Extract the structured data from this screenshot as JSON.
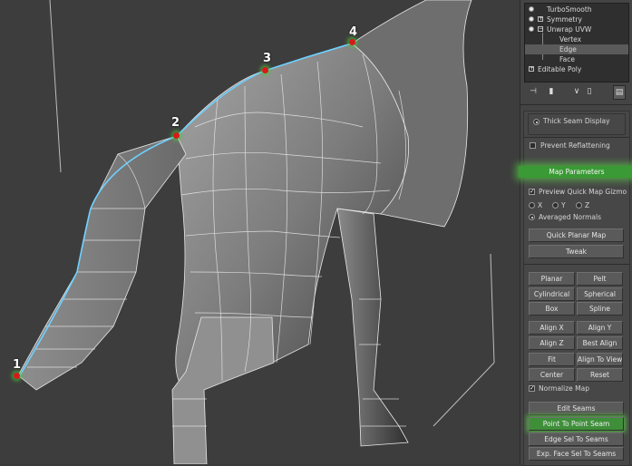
{
  "viewport": {
    "points": [
      {
        "label": "1"
      },
      {
        "label": "2"
      },
      {
        "label": "3"
      },
      {
        "label": "4"
      }
    ]
  },
  "modifier_stack": {
    "items": [
      {
        "label": "TurboSmooth",
        "selected": false
      },
      {
        "label": "Symmetry",
        "selected": false
      },
      {
        "label": "Unwrap UVW",
        "selected": false
      },
      {
        "label": "Vertex",
        "selected": false
      },
      {
        "label": "Edge",
        "selected": true
      },
      {
        "label": "Face",
        "selected": false
      },
      {
        "label": "Editable Poly",
        "selected": false
      }
    ],
    "toolbar_icons": [
      "pin-stack-icon",
      "show-end-result-icon",
      "make-unique-icon",
      "remove-modifier-icon",
      "configure-sets-icon"
    ]
  },
  "options": {
    "thick_seam_display": "Thick Seam Display",
    "prevent_reflattening": "Prevent Reflattening"
  },
  "map_parameters": {
    "header": "Map Parameters",
    "preview_quick_map_gizmo": "Preview Quick Map Gizmo",
    "axis_x": "X",
    "axis_y": "Y",
    "axis_z": "Z",
    "averaged_normals": "Averaged Normals",
    "quick_planar_map": "Quick Planar Map",
    "tweak": "Tweak",
    "planar": "Planar",
    "pelt": "Pelt",
    "cylindrical": "Cylindrical",
    "spherical": "Spherical",
    "box": "Box",
    "spline": "Spline",
    "align_x": "Align X",
    "align_y": "Align Y",
    "align_z": "Align Z",
    "best_align": "Best Align",
    "fit": "Fit",
    "align_to_view": "Align To View",
    "center": "Center",
    "reset": "Reset",
    "normalize_map": "Normalize Map",
    "edit_seams": "Edit Seams",
    "point_to_point_seam": "Point To Point Seam",
    "edge_sel_to_seams": "Edge Sel To Seams",
    "exp_face_sel_to_seams": "Exp. Face Sel To Seams"
  }
}
